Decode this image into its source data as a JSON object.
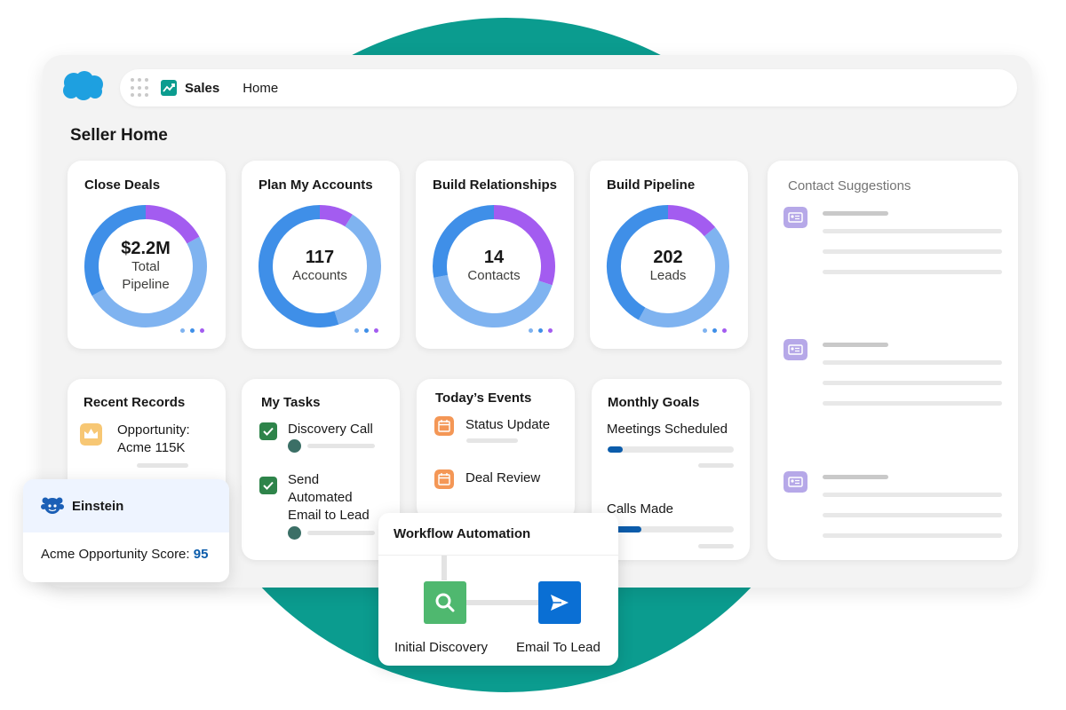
{
  "nav": {
    "app_name": "Sales",
    "home_label": "Home"
  },
  "page": {
    "title": "Seller Home"
  },
  "kpi_cards": [
    {
      "title": "Close Deals",
      "value": "$2.2M",
      "unit_line1": "Total",
      "unit_line2": "Pipeline",
      "segments": [
        {
          "color": "#a35cf0",
          "fraction": 0.17
        },
        {
          "color": "#7fb3f0",
          "fraction": 0.5
        },
        {
          "color": "#3f8fe8",
          "fraction": 0.33
        }
      ]
    },
    {
      "title": "Plan My Accounts",
      "value": "117",
      "unit_line1": "Accounts",
      "unit_line2": "",
      "segments": [
        {
          "color": "#a35cf0",
          "fraction": 0.09
        },
        {
          "color": "#7fb3f0",
          "fraction": 0.36
        },
        {
          "color": "#3f8fe8",
          "fraction": 0.55
        }
      ]
    },
    {
      "title": "Build Relationships",
      "value": "14",
      "unit_line1": "Contacts",
      "unit_line2": "",
      "segments": [
        {
          "color": "#a35cf0",
          "fraction": 0.3
        },
        {
          "color": "#7fb3f0",
          "fraction": 0.42
        },
        {
          "color": "#3f8fe8",
          "fraction": 0.28
        }
      ]
    },
    {
      "title": "Build Pipeline",
      "value": "202",
      "unit_line1": "Leads",
      "unit_line2": "",
      "segments": [
        {
          "color": "#a35cf0",
          "fraction": 0.14
        },
        {
          "color": "#7fb3f0",
          "fraction": 0.44
        },
        {
          "color": "#3f8fe8",
          "fraction": 0.42
        }
      ]
    }
  ],
  "contact_suggestions": {
    "title": "Contact Suggestions"
  },
  "recent_records": {
    "title": "Recent Records",
    "item_line1": "Opportunity:",
    "item_line2": "Acme 115K"
  },
  "my_tasks": {
    "title": "My Tasks",
    "task1": "Discovery Call",
    "task2_line1": "Send",
    "task2_line2": "Automated",
    "task2_line3": "Email to Lead"
  },
  "todays_events": {
    "title": "Today’s Events",
    "event1": "Status Update",
    "event2": "Deal Review"
  },
  "monthly_goals": {
    "title": "Monthly Goals",
    "goal1_label": "Meetings Scheduled",
    "goal1_progress": 0.12,
    "goal2_label": "Calls Made",
    "goal2_progress": 0.27
  },
  "einstein": {
    "title": "Einstein",
    "score_label": "Acme Opportunity Score:",
    "score_value": "95"
  },
  "workflow": {
    "title": "Workflow Automation",
    "step1_label": "Initial Discovery",
    "step2_label": "Email To Lead"
  },
  "colors": {
    "teal_background": "#0b9c8f",
    "brand_blue": "#0b5cab",
    "purple": "#a35cf0",
    "light_blue": "#7fb3f0",
    "mid_blue": "#3f8fe8",
    "task_green": "#2e844a",
    "event_orange": "#f49756",
    "discovery_green": "#4fb86f",
    "email_blue": "#0a6fd4"
  }
}
